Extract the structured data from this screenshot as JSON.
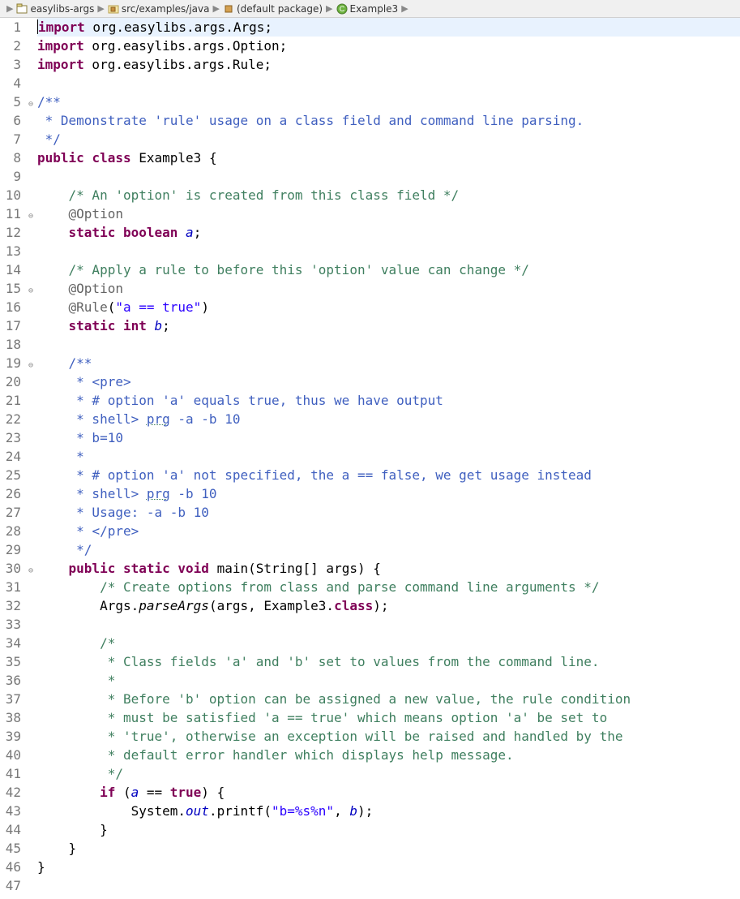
{
  "breadcrumb": {
    "items": [
      {
        "label": "easylibs-args",
        "icon": "project"
      },
      {
        "label": "src/examples/java",
        "icon": "folder"
      },
      {
        "label": "(default package)",
        "icon": "package"
      },
      {
        "label": "Example3",
        "icon": "class"
      },
      {
        "label": "",
        "icon": "none"
      }
    ]
  },
  "code_lines": [
    {
      "n": 1,
      "fold": "",
      "highlight": true,
      "tokens": [
        {
          "t": "import",
          "c": "kw"
        },
        {
          "t": " org.easylibs.args.Args;",
          "c": ""
        }
      ]
    },
    {
      "n": 2,
      "fold": "",
      "tokens": [
        {
          "t": "import",
          "c": "kw"
        },
        {
          "t": " org.easylibs.args.Option;",
          "c": ""
        }
      ]
    },
    {
      "n": 3,
      "fold": "",
      "tokens": [
        {
          "t": "import",
          "c": "kw"
        },
        {
          "t": " org.easylibs.args.Rule;",
          "c": ""
        }
      ]
    },
    {
      "n": 4,
      "fold": "",
      "tokens": []
    },
    {
      "n": 5,
      "fold": "⊖",
      "tokens": [
        {
          "t": "/**",
          "c": "javadoc"
        }
      ]
    },
    {
      "n": 6,
      "fold": "",
      "tokens": [
        {
          "t": " * Demonstrate 'rule' usage on a class field and command line parsing.",
          "c": "javadoc"
        }
      ]
    },
    {
      "n": 7,
      "fold": "",
      "tokens": [
        {
          "t": " */",
          "c": "javadoc"
        }
      ]
    },
    {
      "n": 8,
      "fold": "",
      "tokens": [
        {
          "t": "public",
          "c": "kw"
        },
        {
          "t": " ",
          "c": ""
        },
        {
          "t": "class",
          "c": "kw"
        },
        {
          "t": " Example3 {",
          "c": ""
        }
      ]
    },
    {
      "n": 9,
      "fold": "",
      "tokens": []
    },
    {
      "n": 10,
      "fold": "",
      "tokens": [
        {
          "t": "    ",
          "c": ""
        },
        {
          "t": "/* An 'option' is created from this class field */",
          "c": "comment"
        }
      ]
    },
    {
      "n": 11,
      "fold": "⊖",
      "tokens": [
        {
          "t": "    ",
          "c": ""
        },
        {
          "t": "@Option",
          "c": "annotation"
        }
      ]
    },
    {
      "n": 12,
      "fold": "",
      "tokens": [
        {
          "t": "    ",
          "c": ""
        },
        {
          "t": "static",
          "c": "kw"
        },
        {
          "t": " ",
          "c": ""
        },
        {
          "t": "boolean",
          "c": "kw"
        },
        {
          "t": " ",
          "c": ""
        },
        {
          "t": "a",
          "c": "field-static"
        },
        {
          "t": ";",
          "c": ""
        }
      ]
    },
    {
      "n": 13,
      "fold": "",
      "tokens": []
    },
    {
      "n": 14,
      "fold": "",
      "tokens": [
        {
          "t": "    ",
          "c": ""
        },
        {
          "t": "/* Apply a rule to before this 'option' value can change */",
          "c": "comment"
        }
      ]
    },
    {
      "n": 15,
      "fold": "⊖",
      "tokens": [
        {
          "t": "    ",
          "c": ""
        },
        {
          "t": "@Option",
          "c": "annotation"
        }
      ]
    },
    {
      "n": 16,
      "fold": "",
      "tokens": [
        {
          "t": "    ",
          "c": ""
        },
        {
          "t": "@Rule",
          "c": "annotation"
        },
        {
          "t": "(",
          "c": ""
        },
        {
          "t": "\"a == true\"",
          "c": "string"
        },
        {
          "t": ")",
          "c": ""
        }
      ]
    },
    {
      "n": 17,
      "fold": "",
      "tokens": [
        {
          "t": "    ",
          "c": ""
        },
        {
          "t": "static",
          "c": "kw"
        },
        {
          "t": " ",
          "c": ""
        },
        {
          "t": "int",
          "c": "kw"
        },
        {
          "t": " ",
          "c": ""
        },
        {
          "t": "b",
          "c": "field-static"
        },
        {
          "t": ";",
          "c": ""
        }
      ]
    },
    {
      "n": 18,
      "fold": "",
      "tokens": []
    },
    {
      "n": 19,
      "fold": "⊖",
      "tokens": [
        {
          "t": "    ",
          "c": ""
        },
        {
          "t": "/**",
          "c": "javadoc"
        }
      ]
    },
    {
      "n": 20,
      "fold": "",
      "tokens": [
        {
          "t": "    ",
          "c": ""
        },
        {
          "t": " * ",
          "c": "javadoc"
        },
        {
          "t": "<pre>",
          "c": "javadoc-tag"
        }
      ]
    },
    {
      "n": 21,
      "fold": "",
      "tokens": [
        {
          "t": "    ",
          "c": ""
        },
        {
          "t": " * # option 'a' equals true, thus we have output",
          "c": "javadoc"
        }
      ]
    },
    {
      "n": 22,
      "fold": "",
      "tokens": [
        {
          "t": "    ",
          "c": ""
        },
        {
          "t": " * shell> ",
          "c": "javadoc"
        },
        {
          "t": "prg",
          "c": "javadoc underline"
        },
        {
          "t": " -a -b 10",
          "c": "javadoc"
        }
      ]
    },
    {
      "n": 23,
      "fold": "",
      "tokens": [
        {
          "t": "    ",
          "c": ""
        },
        {
          "t": " * b=10",
          "c": "javadoc"
        }
      ]
    },
    {
      "n": 24,
      "fold": "",
      "tokens": [
        {
          "t": "    ",
          "c": ""
        },
        {
          "t": " *",
          "c": "javadoc"
        }
      ]
    },
    {
      "n": 25,
      "fold": "",
      "tokens": [
        {
          "t": "    ",
          "c": ""
        },
        {
          "t": " * # option 'a' not specified, the a == false, we get usage instead",
          "c": "javadoc"
        }
      ]
    },
    {
      "n": 26,
      "fold": "",
      "tokens": [
        {
          "t": "    ",
          "c": ""
        },
        {
          "t": " * shell> ",
          "c": "javadoc"
        },
        {
          "t": "prg",
          "c": "javadoc underline"
        },
        {
          "t": " -b 10",
          "c": "javadoc"
        }
      ]
    },
    {
      "n": 27,
      "fold": "",
      "tokens": [
        {
          "t": "    ",
          "c": ""
        },
        {
          "t": " * Usage: -a -b 10",
          "c": "javadoc"
        }
      ]
    },
    {
      "n": 28,
      "fold": "",
      "tokens": [
        {
          "t": "    ",
          "c": ""
        },
        {
          "t": " * ",
          "c": "javadoc"
        },
        {
          "t": "</pre>",
          "c": "javadoc-tag"
        }
      ]
    },
    {
      "n": 29,
      "fold": "",
      "tokens": [
        {
          "t": "    ",
          "c": ""
        },
        {
          "t": " */",
          "c": "javadoc"
        }
      ]
    },
    {
      "n": 30,
      "fold": "⊖",
      "tokens": [
        {
          "t": "    ",
          "c": ""
        },
        {
          "t": "public",
          "c": "kw"
        },
        {
          "t": " ",
          "c": ""
        },
        {
          "t": "static",
          "c": "kw"
        },
        {
          "t": " ",
          "c": ""
        },
        {
          "t": "void",
          "c": "kw"
        },
        {
          "t": " main(String[] args) {",
          "c": ""
        }
      ]
    },
    {
      "n": 31,
      "fold": "",
      "tokens": [
        {
          "t": "        ",
          "c": ""
        },
        {
          "t": "/* Create options from class and parse command line arguments */",
          "c": "comment"
        }
      ]
    },
    {
      "n": 32,
      "fold": "",
      "tokens": [
        {
          "t": "        Args.",
          "c": ""
        },
        {
          "t": "parseArgs",
          "c": "method-static"
        },
        {
          "t": "(args, Example3.",
          "c": ""
        },
        {
          "t": "class",
          "c": "kw"
        },
        {
          "t": ");",
          "c": ""
        }
      ]
    },
    {
      "n": 33,
      "fold": "",
      "tokens": []
    },
    {
      "n": 34,
      "fold": "",
      "tokens": [
        {
          "t": "        ",
          "c": ""
        },
        {
          "t": "/*",
          "c": "comment"
        }
      ]
    },
    {
      "n": 35,
      "fold": "",
      "tokens": [
        {
          "t": "        ",
          "c": ""
        },
        {
          "t": " * Class fields 'a' and 'b' set to values from the command line.",
          "c": "comment"
        }
      ]
    },
    {
      "n": 36,
      "fold": "",
      "tokens": [
        {
          "t": "        ",
          "c": ""
        },
        {
          "t": " *",
          "c": "comment"
        }
      ]
    },
    {
      "n": 37,
      "fold": "",
      "tokens": [
        {
          "t": "        ",
          "c": ""
        },
        {
          "t": " * Before 'b' option can be assigned a new value, the rule condition",
          "c": "comment"
        }
      ]
    },
    {
      "n": 38,
      "fold": "",
      "tokens": [
        {
          "t": "        ",
          "c": ""
        },
        {
          "t": " * must be satisfied 'a == true' which means option 'a' be set to",
          "c": "comment"
        }
      ]
    },
    {
      "n": 39,
      "fold": "",
      "tokens": [
        {
          "t": "        ",
          "c": ""
        },
        {
          "t": " * 'true', otherwise an exception will be raised and handled by the",
          "c": "comment"
        }
      ]
    },
    {
      "n": 40,
      "fold": "",
      "tokens": [
        {
          "t": "        ",
          "c": ""
        },
        {
          "t": " * default error handler which displays help message.",
          "c": "comment"
        }
      ]
    },
    {
      "n": 41,
      "fold": "",
      "tokens": [
        {
          "t": "        ",
          "c": ""
        },
        {
          "t": " */",
          "c": "comment"
        }
      ]
    },
    {
      "n": 42,
      "fold": "",
      "tokens": [
        {
          "t": "        ",
          "c": ""
        },
        {
          "t": "if",
          "c": "kw"
        },
        {
          "t": " (",
          "c": ""
        },
        {
          "t": "a",
          "c": "field-static"
        },
        {
          "t": " == ",
          "c": ""
        },
        {
          "t": "true",
          "c": "kw"
        },
        {
          "t": ") {",
          "c": ""
        }
      ]
    },
    {
      "n": 43,
      "fold": "",
      "tokens": [
        {
          "t": "            System.",
          "c": ""
        },
        {
          "t": "out",
          "c": "field-static"
        },
        {
          "t": ".printf(",
          "c": ""
        },
        {
          "t": "\"b=%s%n\"",
          "c": "string"
        },
        {
          "t": ", ",
          "c": ""
        },
        {
          "t": "b",
          "c": "field-static"
        },
        {
          "t": ");",
          "c": ""
        }
      ]
    },
    {
      "n": 44,
      "fold": "",
      "tokens": [
        {
          "t": "        }",
          "c": ""
        }
      ]
    },
    {
      "n": 45,
      "fold": "",
      "tokens": [
        {
          "t": "    }",
          "c": ""
        }
      ]
    },
    {
      "n": 46,
      "fold": "",
      "tokens": [
        {
          "t": "}",
          "c": ""
        }
      ]
    },
    {
      "n": 47,
      "fold": "",
      "tokens": []
    }
  ]
}
